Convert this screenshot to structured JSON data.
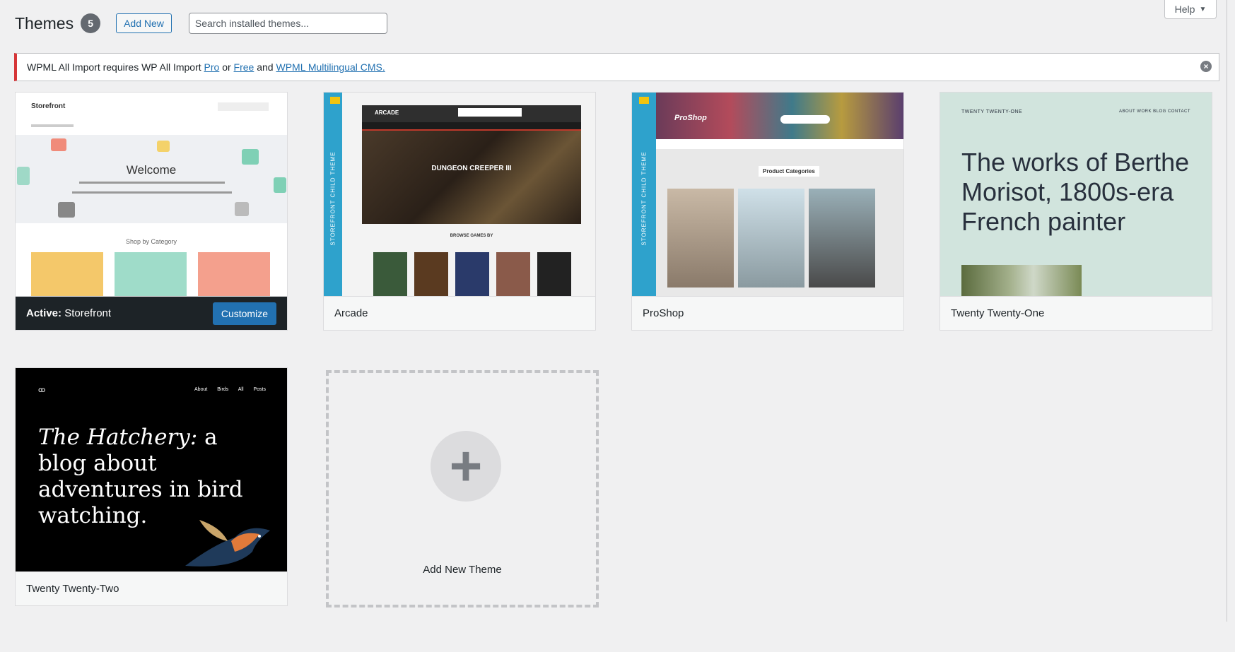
{
  "header": {
    "title": "Themes",
    "count": "5",
    "add_new_label": "Add New",
    "search_placeholder": "Search installed themes..."
  },
  "help": {
    "label": "Help"
  },
  "notice": {
    "text_before": "WPML All Import requires WP All Import ",
    "link_pro": "Pro",
    "text_or": " or ",
    "link_free": "Free",
    "text_and": " and ",
    "link_wpml": "WPML Multilingual CMS."
  },
  "themes": [
    {
      "name": "Storefront",
      "active_prefix": "Active:",
      "customize_label": "Customize",
      "preview": {
        "brand": "Storefront",
        "welcome": "Welcome",
        "shop_by_category": "Shop by Category"
      }
    },
    {
      "name": "Arcade",
      "preview": {
        "ribbon": "STOREFRONT CHILD THEME",
        "logo": "ARCADE",
        "banner_title": "DUNGEON CREEPER III",
        "section": "BROWSE GAMES BY"
      }
    },
    {
      "name": "ProShop",
      "preview": {
        "ribbon": "STOREFRONT CHILD THEME",
        "logo": "ProShop",
        "section": "Product Categories"
      }
    },
    {
      "name": "Twenty Twenty-One",
      "preview": {
        "site": "TWENTY TWENTY-ONE",
        "nav": "ABOUT  WORK  BLOG  CONTACT",
        "headline": "The works of Berthe Morisot, 1800s-era French painter"
      }
    },
    {
      "name": "Twenty Twenty-Two",
      "preview": {
        "logo": "ꝏ",
        "nav": "About Birds All Posts",
        "headline_italic": "The Hatchery:",
        "headline_rest": " a blog about adventures in bird watching."
      }
    }
  ],
  "add_new_theme": {
    "label": "Add New Theme"
  },
  "colors": {
    "accent": "#2271b1",
    "notice_error": "#d63638",
    "active_bar": "#1d2327",
    "child_theme_ribbon": "#2ea2cc"
  }
}
